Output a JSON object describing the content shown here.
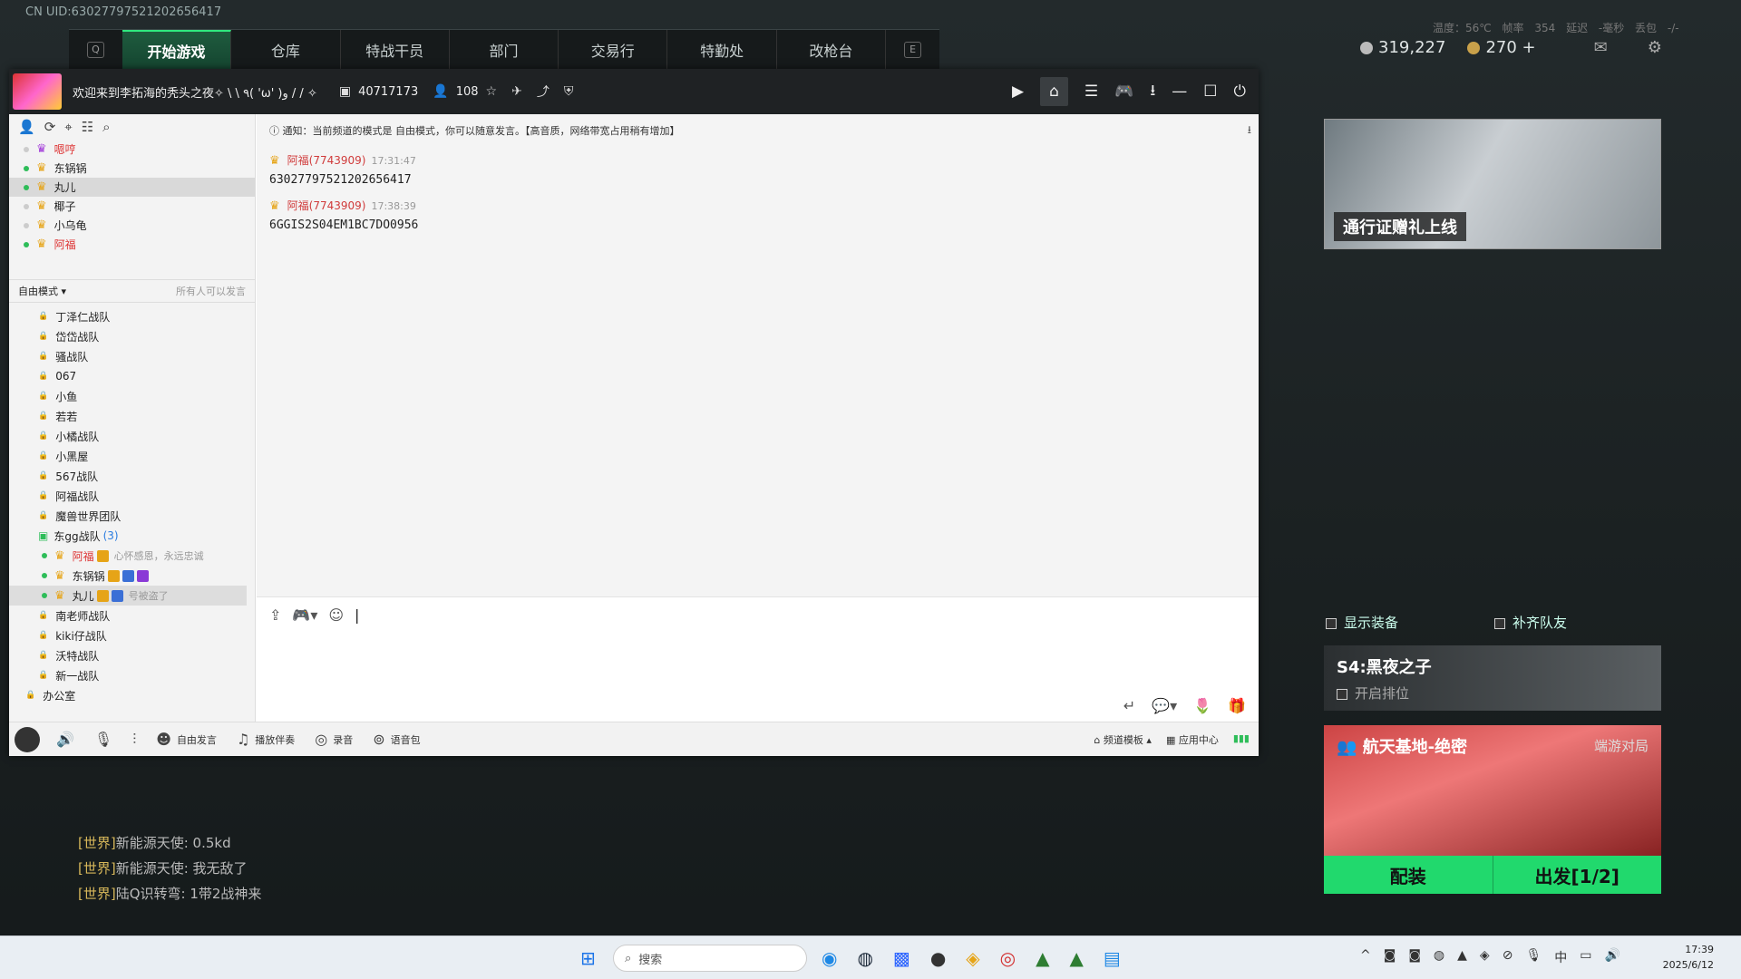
{
  "game": {
    "uid": "CN UID:63027797521202656417",
    "left_key": "Q",
    "right_key": "E",
    "tabs": [
      "开始游戏",
      "仓库",
      "特战干员",
      "部门",
      "交易行",
      "特勤处",
      "改枪台"
    ],
    "stats": "温度：56℃ 帧率 354 延迟 -毫秒 丢包 -/-",
    "currency1": "319,227",
    "currency2": "270 +"
  },
  "chat": {
    "title": "欢迎来到李拓海的秃头之夜✧ \\ \\ ٩( 'ω' )و / / ✧",
    "channel_id": "40717173",
    "online": "108",
    "members": [
      {
        "name": "嗯哼",
        "online": false,
        "purple": true
      },
      {
        "name": "东锅锅",
        "online": true
      },
      {
        "name": "丸儿",
        "online": true
      },
      {
        "name": "椰子",
        "online": false
      },
      {
        "name": "小乌龟",
        "online": false
      },
      {
        "name": "阿福",
        "online": true
      }
    ],
    "mode_label": "自由模式 ▾",
    "mode_right": "所有人可以发言",
    "channels_before": [
      "丁泽仁战队",
      "岱岱战队",
      "骚战队",
      "067",
      "小鱼",
      "若若",
      "小橘战队",
      "小黑屋",
      "567战队",
      "阿福战队",
      "魔兽世界团队"
    ],
    "active_channel": "东gg战队",
    "active_count": "(3)",
    "sub_members": [
      {
        "name": "阿福",
        "sig": "心怀感恩，永远忠诚"
      },
      {
        "name": "东锅锅",
        "sig": ""
      },
      {
        "name": "丸儿",
        "sig": "号被盗了"
      }
    ],
    "channels_after": [
      "南老师战队",
      "kiki仔战队",
      "沃特战队",
      "新一战队"
    ],
    "office": "办公室",
    "notice": "通知：当前频道的模式是 自由模式，你可以随意发言。【高音质，网络带宽占用稍有增加】",
    "messages": [
      {
        "who": "阿福(7743909)",
        "time": "17:31:47",
        "body": "63027797521202656417"
      },
      {
        "who": "阿福(7743909)",
        "time": "17:38:39",
        "body": "6GGIS2S04EM1BC7DO0956"
      }
    ],
    "bottom": {
      "free": "自由发言",
      "music": "播放伴奏",
      "record": "录音",
      "voicepack": "语音包",
      "template": "频道模板",
      "appcenter": "应用中心"
    }
  },
  "right": {
    "banner": "通行证赠礼上线",
    "show_equip": "显示装备",
    "fill_team": "补齐队友",
    "season": "S4:黑夜之子",
    "ranked": "开启排位",
    "map": "航天基地-绝密",
    "map_mode": "端游对局",
    "equip": "配装",
    "go": "出发[1/2]"
  },
  "world_chat": [
    {
      "ch": "[世界]",
      "text": "新能源天使: 0.5kd"
    },
    {
      "ch": "[世界]",
      "text": "新能源天使: 我无敌了"
    },
    {
      "ch": "[世界]",
      "text": "陆Q识转弯: 1带2战神来"
    }
  ],
  "taskbar": {
    "search": "搜索",
    "time": "17:39",
    "date": "2025/6/12",
    "ime": "中"
  }
}
